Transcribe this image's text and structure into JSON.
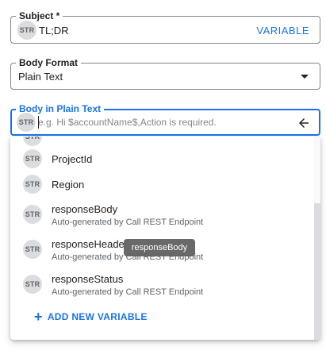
{
  "subject": {
    "label": "Subject *",
    "chip": "STR",
    "value": "TL;DR",
    "variable_button": "VARIABLE"
  },
  "body_format": {
    "label": "Body Format",
    "value": "Plain Text",
    "caret_icon": "caret-down-icon"
  },
  "body_plain": {
    "label": "Body in Plain Text",
    "chip": "STR",
    "placeholder": "e.g. Hi $accountName$,Action is required.",
    "value": "",
    "action_icon": "arrow-back-icon"
  },
  "variables": {
    "items": [
      {
        "chip": "STR",
        "name": "ProjectId",
        "sub": ""
      },
      {
        "chip": "STR",
        "name": "Region",
        "sub": ""
      },
      {
        "chip": "STR",
        "name": "responseBody",
        "sub": "Auto-generated by Call REST Endpoint"
      },
      {
        "chip": "STR",
        "name": "responseHeade",
        "sub": "Auto-generated by Call REST Endpoint"
      },
      {
        "chip": "STR",
        "name": "responseStatus",
        "sub": "Auto-generated by Call REST Endpoint"
      }
    ],
    "add_label": "ADD NEW VARIABLE",
    "add_icon": "plus-icon"
  },
  "tooltip": {
    "text": "responseBody"
  },
  "colors": {
    "accent": "#1a73e8",
    "chip_bg": "#dadce0",
    "tooltip_bg": "#616161"
  }
}
